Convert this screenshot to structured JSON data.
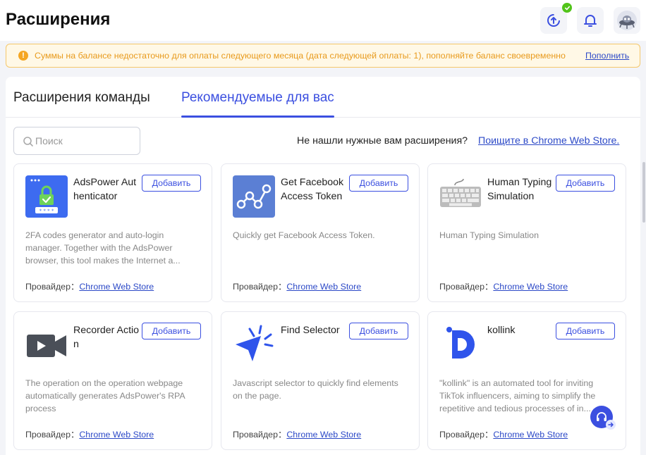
{
  "header": {
    "title": "Расширения",
    "icons": [
      "sync-icon",
      "check-icon",
      "bell-icon",
      "avatar"
    ]
  },
  "notice": {
    "text": "Суммы на балансе недостаточно для оплаты следующего месяца (дата следующей оплаты: 1), пополняйте баланс своевременно",
    "link": "Пополнить",
    "color": "#e89a1c"
  },
  "tabs": [
    {
      "label": "Расширения команды",
      "active": false
    },
    {
      "label": "Рекомендуемые для вас",
      "active": true
    }
  ],
  "search": {
    "placeholder": "Поиск",
    "value": ""
  },
  "store_hint": {
    "text": "Не нашли нужные вам расширения?",
    "link": " Поищите в Chrome Web Store."
  },
  "cards": [
    {
      "title": "AdsPower Authenticator",
      "add_label": "Добавить",
      "description": "2FA codes generator and auto-login manager. Together with the AdsPower browser, this tool makes the Internet a...",
      "provider_label": "Провайдер：",
      "provider": "Chrome Web Store",
      "icon": "adspower-authenticator-icon"
    },
    {
      "title": "Get Facebook Access Token",
      "add_label": "Добавить",
      "description": "Quickly get Facebook Access Token.",
      "provider_label": "Провайдер：",
      "provider": "Chrome Web Store",
      "icon": "facebook-token-icon"
    },
    {
      "title": "Human Typing Simulation",
      "add_label": "Добавить",
      "description": "Human Typing Simulation",
      "provider_label": "Провайдер：",
      "provider": "Chrome Web Store",
      "icon": "keyboard-icon"
    },
    {
      "title": "Recorder Action",
      "add_label": "Добавить",
      "description": "The operation on the operation webpage automatically generates AdsPower's RPA process",
      "provider_label": "Провайдер：",
      "provider": "Chrome Web Store",
      "icon": "video-camera-icon"
    },
    {
      "title": "Find Selector",
      "add_label": "Добавить",
      "description": "Javascript selector to quickly find elements on the page.",
      "provider_label": "Провайдер：",
      "provider": "Chrome Web Store",
      "icon": "cursor-click-icon"
    },
    {
      "title": "kollink",
      "add_label": "Добавить",
      "description": "\"kollink\" is an automated tool for inviting TikTok influencers, aiming to simplify the repetitive and tedious processes of in...",
      "provider_label": "Провайдер：",
      "provider": "Chrome Web Store",
      "icon": "kollink-logo-icon"
    }
  ],
  "colors": {
    "accent": "#3b4fe0",
    "link": "#2c49c7",
    "warning": "#f5a623",
    "success": "#52c41a"
  }
}
